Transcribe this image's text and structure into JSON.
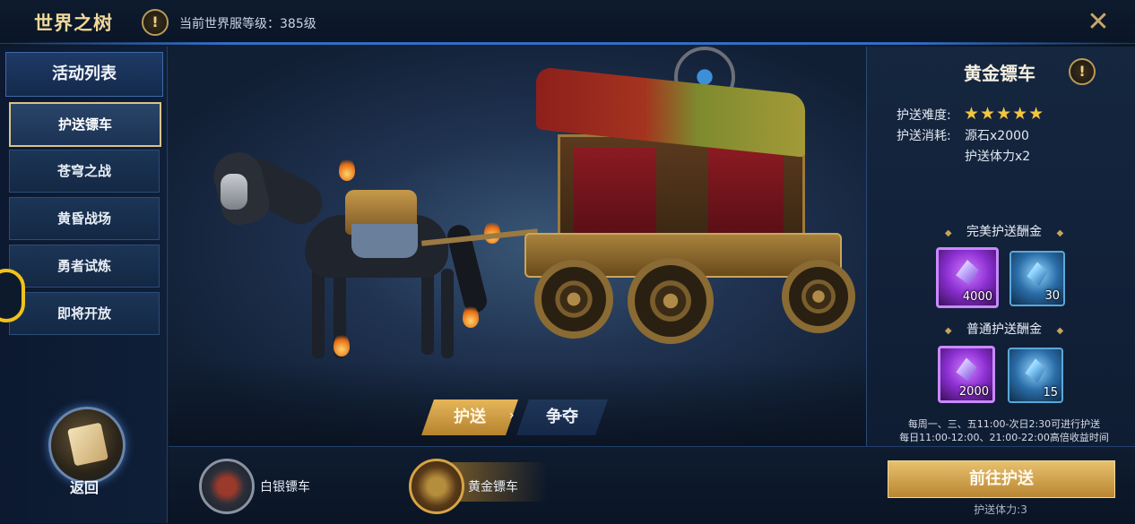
{
  "header": {
    "title": "世界之树",
    "info_icon": "!",
    "server_level": "当前世界服等级：385级",
    "close_icon": "✕"
  },
  "sidebar": {
    "heading": "活动列表",
    "items": [
      {
        "label": "护送镖车",
        "active": true
      },
      {
        "label": "苍穹之战",
        "active": false
      },
      {
        "label": "黄昏战场",
        "active": false
      },
      {
        "label": "勇者试炼",
        "active": false
      },
      {
        "label": "即将开放",
        "active": false
      }
    ],
    "back_label": "返回"
  },
  "scene": {
    "tab_escort": "护送",
    "tab_contest": "争夺",
    "selected_tab": "护送"
  },
  "details": {
    "title": "黄金镖车",
    "info_icon": "!",
    "difficulty_label": "护送难度:",
    "difficulty_stars": 5,
    "stars_text": "★★★★★",
    "cost_label": "护送消耗:",
    "cost_1": "源石x2000",
    "cost_2": "护送体力x2",
    "perfect_reward_title": "完美护送酬金",
    "perfect_rewards": [
      {
        "icon": "purple-crystal-icon",
        "qty": "4000"
      },
      {
        "icon": "blue-crystal-icon",
        "qty": "30"
      }
    ],
    "normal_reward_title": "普通护送酬金",
    "normal_rewards": [
      {
        "icon": "purple-crystal-icon",
        "qty": "2000"
      },
      {
        "icon": "blue-crystal-icon",
        "qty": "15"
      }
    ],
    "schedule_1": "每周一、三、五11:00-次日2:30可进行护送",
    "schedule_2": "每日11:00-12:00、21:00-22:00高倍收益时间"
  },
  "bottom": {
    "carts": [
      {
        "label": "白银镖车",
        "selected": false
      },
      {
        "label": "黄金镖车",
        "selected": true
      }
    ],
    "go_button": "前往护送",
    "stamina": "护送体力:3"
  },
  "colors": {
    "gold_accent": "#e6b65a",
    "panel_blue": "#15263f",
    "star_yellow": "#f3c640"
  }
}
